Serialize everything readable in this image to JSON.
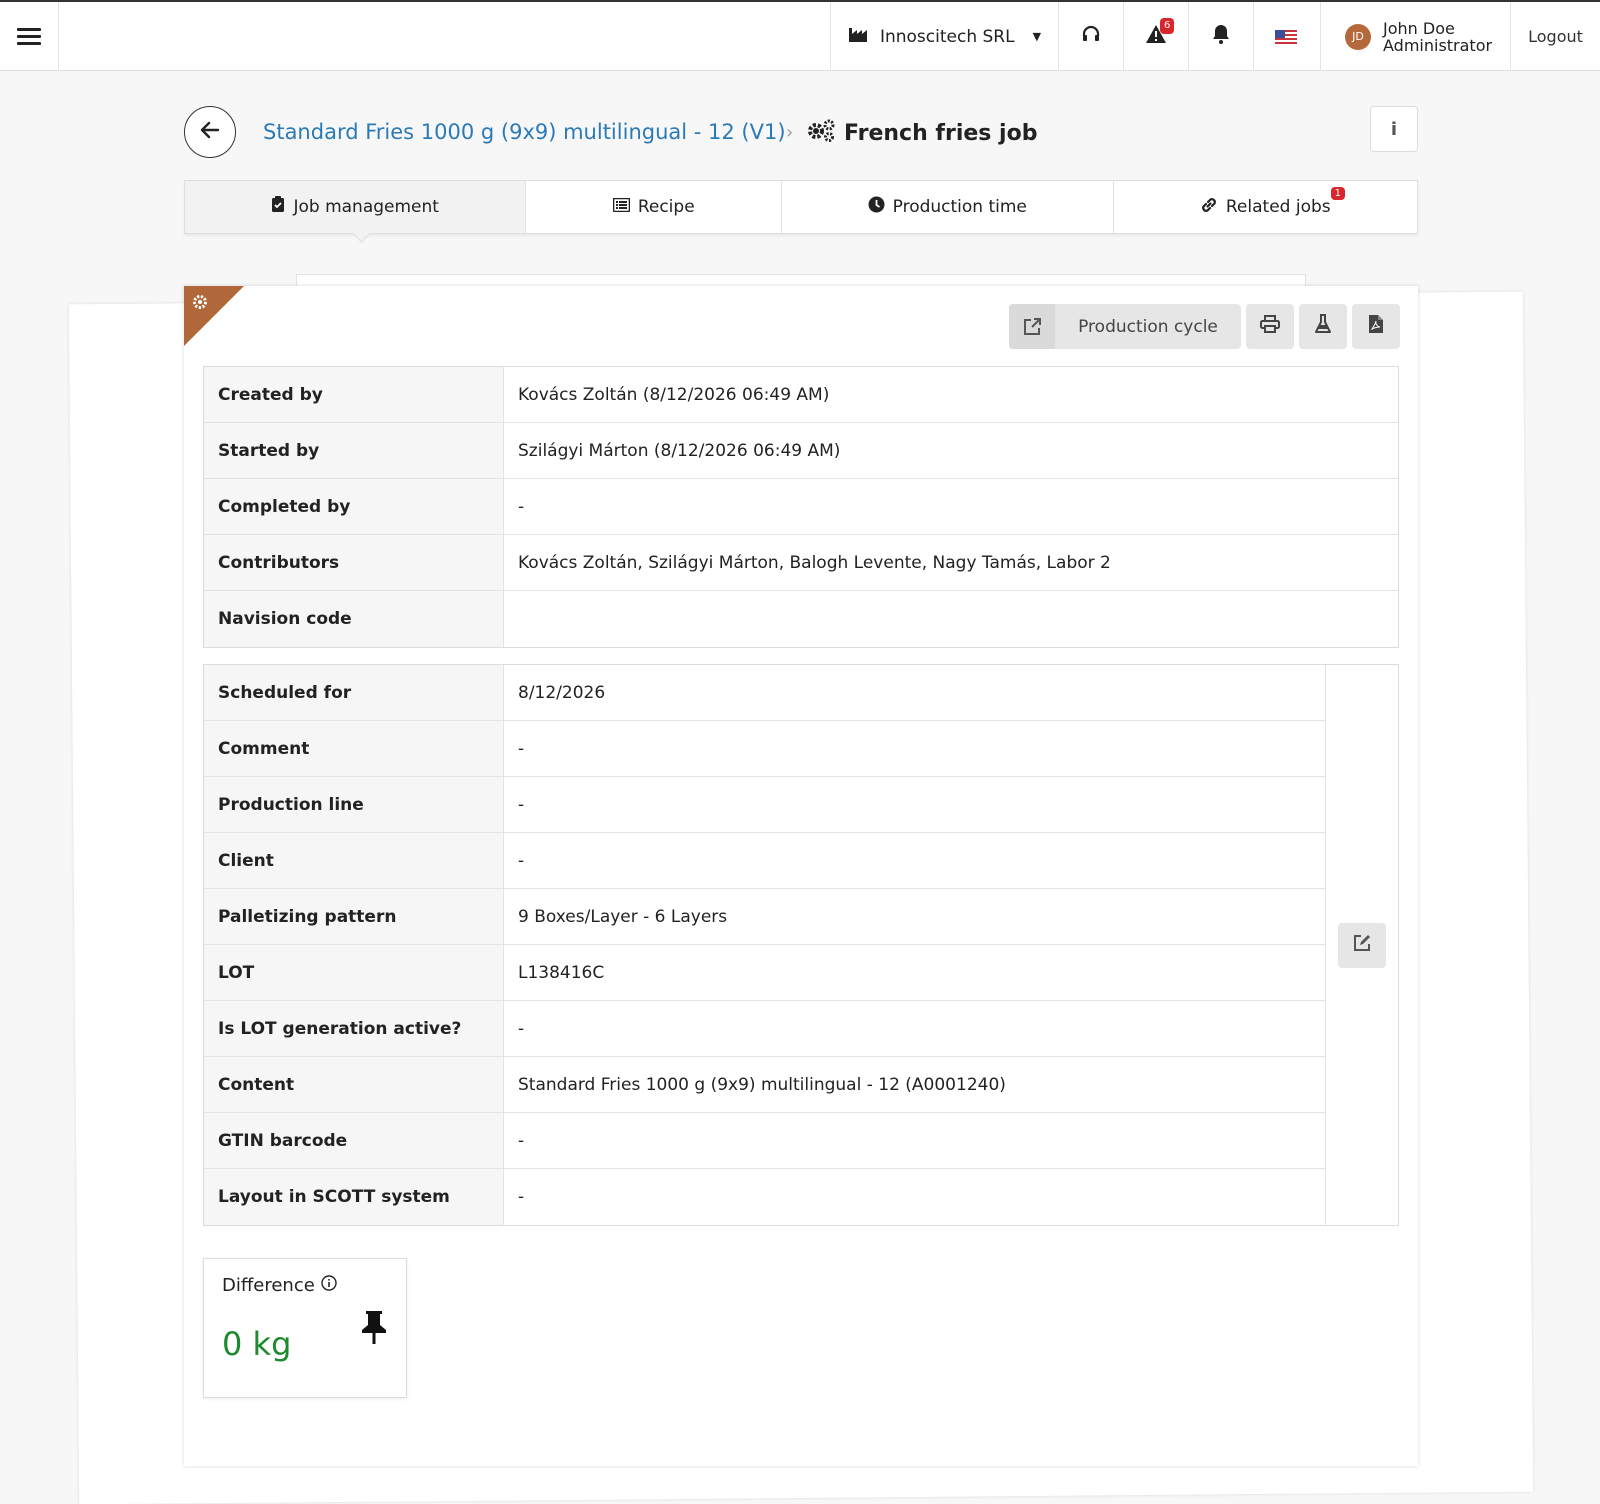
{
  "topbar": {
    "company": "Innoscitech SRL",
    "alerts_badge": "6",
    "user": {
      "initials": "JD",
      "name": "John Doe",
      "role": "Administrator"
    },
    "logout": "Logout"
  },
  "header": {
    "breadcrumb_link": "Standard Fries 1000 g (9x9) multilingual - 12 (V1)",
    "current": "French fries job"
  },
  "tabs": [
    {
      "label": "Job management",
      "icon": "clipboard-check-icon"
    },
    {
      "label": "Recipe",
      "icon": "list-icon"
    },
    {
      "label": "Production time",
      "icon": "clock-icon"
    },
    {
      "label": "Related jobs",
      "icon": "link-icon",
      "badge": "1"
    }
  ],
  "actions": {
    "production_cycle": "Production cycle"
  },
  "job_info": [
    {
      "label": "Created by",
      "value": "Kovács Zoltán (8/12/2026 06:49 AM)"
    },
    {
      "label": "Started by",
      "value": "Szilágyi Márton (8/12/2026 06:49 AM)"
    },
    {
      "label": "Completed by",
      "value": "-"
    },
    {
      "label": "Contributors",
      "value": "Kovács Zoltán, Szilágyi Márton, Balogh Levente, Nagy Tamás, Labor 2"
    },
    {
      "label": "Navision code",
      "value": ""
    }
  ],
  "job_details": [
    {
      "label": "Scheduled for",
      "value": "8/12/2026"
    },
    {
      "label": "Comment",
      "value": "-"
    },
    {
      "label": "Production line",
      "value": "-"
    },
    {
      "label": "Client",
      "value": "-"
    },
    {
      "label": "Palletizing pattern",
      "value": "9 Boxes/Layer - 6 Layers"
    },
    {
      "label": "LOT",
      "value": "L138416C"
    },
    {
      "label": "Is LOT generation active?",
      "value": "-"
    },
    {
      "label": "Content",
      "value": "Standard Fries 1000 g (9x9) multilingual - 12 (A0001240)"
    },
    {
      "label": "GTIN barcode",
      "value": "-"
    },
    {
      "label": "Layout in SCOTT system",
      "value": "-"
    }
  ],
  "difference": {
    "title": "Difference",
    "value": "0 kg"
  },
  "colors": {
    "accent_link": "#2a7ab8",
    "corner": "#b0683a",
    "badge": "#d9262c",
    "positive": "#1e8a2e"
  }
}
